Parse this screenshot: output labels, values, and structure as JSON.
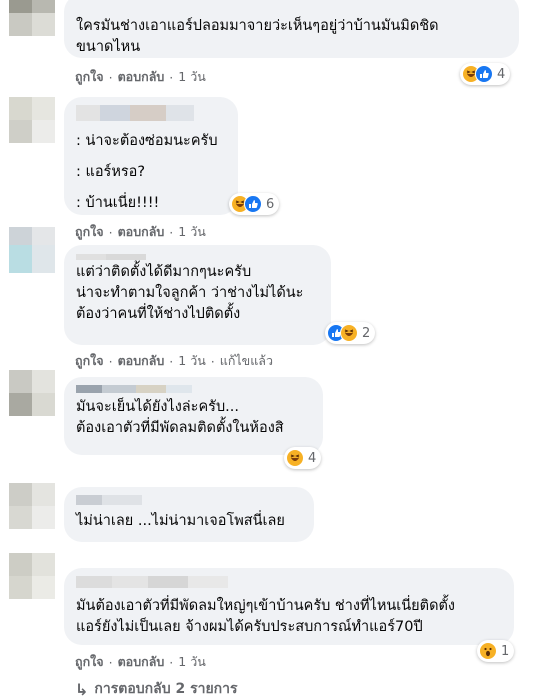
{
  "comments": [
    {
      "lines": [
        "ใครมันช่างเอาแอร์ปลอมมาจายว่ะเห็นๆอยู่ว่าบ้านมันมิดชิด",
        "ขนาดไหน"
      ],
      "actions": {
        "like": "ถูกใจ",
        "reply": "ตอบกลับ",
        "time": "1 วัน"
      },
      "reaction_count": "4",
      "reaction_icons": [
        "haha-icon",
        "like-icon"
      ]
    },
    {
      "lines": [
        ": น่าจะต้องซ่อมนะครับ",
        ": แอร์หรอ?",
        ": บ้านเนี่ย!!!!"
      ],
      "actions": {
        "like": "ถูกใจ",
        "reply": "ตอบกลับ",
        "time": "1 วัน"
      },
      "reaction_count": "6",
      "reaction_icons": [
        "haha-icon",
        "like-icon"
      ]
    },
    {
      "lines": [
        "แต่ว่าติดตั้งได้ดีมากๆนะครับ",
        "น่าจะทำตามใจลูกค้า ว่าช่างไม่ได้นะ",
        "ต้องว่าคนที่ให้ช่างไปติดตั้ง"
      ],
      "actions": {
        "like": "ถูกใจ",
        "reply": "ตอบกลับ",
        "time": "1 วัน",
        "edited": "แก้ไขแล้ว"
      },
      "reaction_count": "2",
      "reaction_icons": [
        "like-icon",
        "haha-icon"
      ]
    },
    {
      "lines": [
        "มันจะเย็นได้ยังไงล่ะครับ...",
        "ต้องเอาตัวที่มีพัดลมติดตั้งในห้องสิ"
      ],
      "actions": {},
      "reaction_count": "4",
      "reaction_icons": [
        "haha-icon"
      ]
    },
    {
      "lines": [
        "ไม่น่าเลย ...ไม่น่ามาเจอโพสนี่เลย"
      ],
      "actions": {},
      "reaction_count": "",
      "reaction_icons": []
    },
    {
      "lines": [
        "มันต้องเอาตัวที่มีพัดลมใหญ่ๆเข้าบ้านครับ ช่างที่ไหนเนี่ยติดตั้ง",
        "แอร์ยังไม่เป็นเลย จ้างผมได้ครับประสบการณ์ทำแอร์70ปี"
      ],
      "actions": {
        "like": "ถูกใจ",
        "reply": "ตอบกลับ",
        "time": "1 วัน"
      },
      "reaction_count": "1",
      "reaction_icons": [
        "wow-icon"
      ]
    }
  ],
  "more_replies": "การตอบกลับ 2 รายการ",
  "colors": {
    "bubble": "#f0f2f5",
    "meta": "#65676b",
    "like": "#1877f2",
    "haha": "#f7b125"
  }
}
